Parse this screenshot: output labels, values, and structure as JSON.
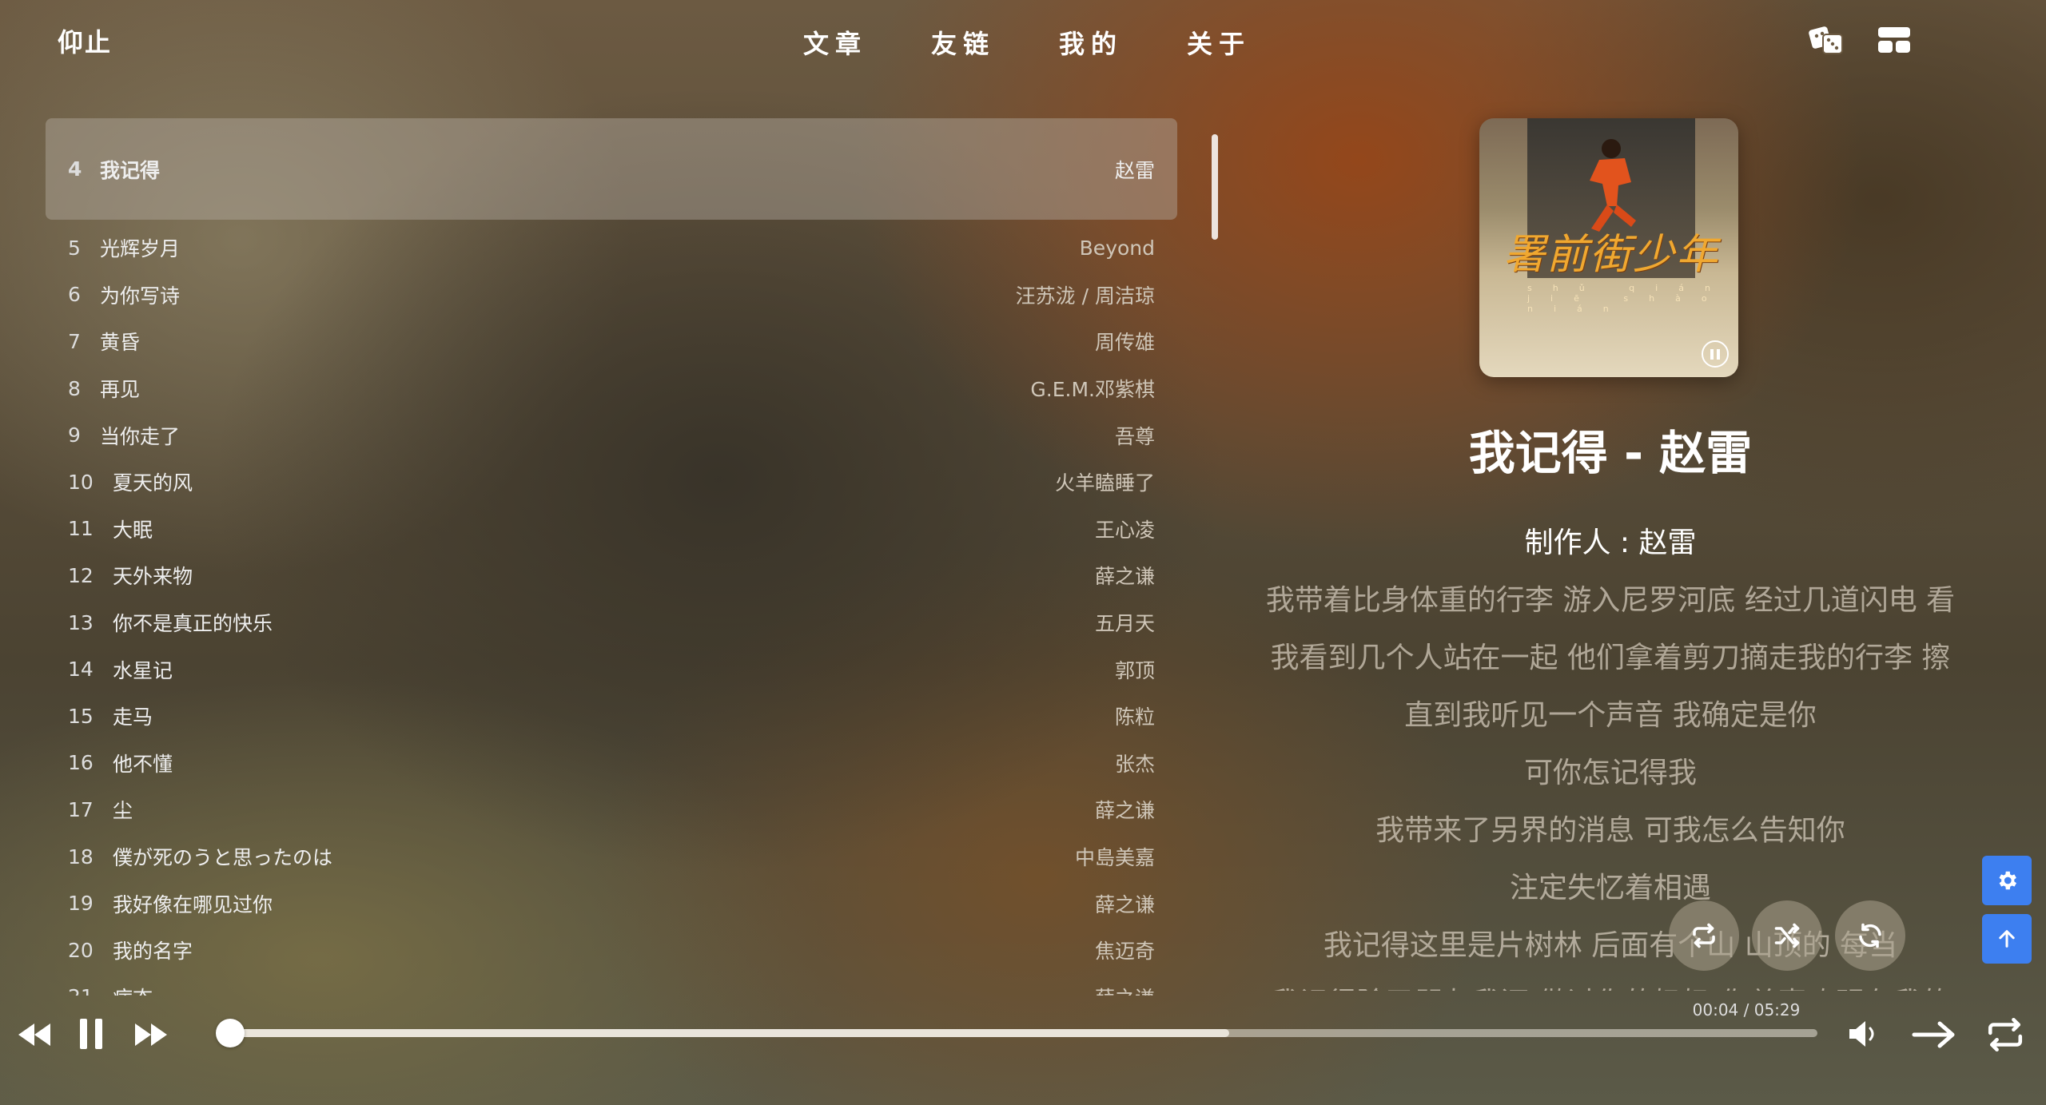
{
  "header": {
    "brand": "仰止",
    "nav": [
      "文章",
      "友链",
      "我的",
      "关于"
    ],
    "icons": [
      "dice-icon",
      "layout-icon"
    ]
  },
  "playlist": [
    {
      "num": "4",
      "title": "我记得",
      "artist": "赵雷",
      "active": true
    },
    {
      "num": "5",
      "title": "光辉岁月",
      "artist": "Beyond"
    },
    {
      "num": "6",
      "title": "为你写诗",
      "artist": "汪苏泷 / 周洁琼"
    },
    {
      "num": "7",
      "title": "黄昏",
      "artist": "周传雄"
    },
    {
      "num": "8",
      "title": "再见",
      "artist": "G.E.M.邓紫棋"
    },
    {
      "num": "9",
      "title": "当你走了",
      "artist": "吾尊"
    },
    {
      "num": "10",
      "title": "夏天的风",
      "artist": "火羊瞌睡了"
    },
    {
      "num": "11",
      "title": "大眠",
      "artist": "王心凌"
    },
    {
      "num": "12",
      "title": "天外来物",
      "artist": "薛之谦"
    },
    {
      "num": "13",
      "title": "你不是真正的快乐",
      "artist": "五月天"
    },
    {
      "num": "14",
      "title": "水星记",
      "artist": "郭顶"
    },
    {
      "num": "15",
      "title": "走马",
      "artist": "陈粒"
    },
    {
      "num": "16",
      "title": "他不懂",
      "artist": "张杰"
    },
    {
      "num": "17",
      "title": "尘",
      "artist": "薛之谦"
    },
    {
      "num": "18",
      "title": "僕が死のうと思ったのは",
      "artist": "中島美嘉"
    },
    {
      "num": "19",
      "title": "我好像在哪见过你",
      "artist": "薛之谦"
    },
    {
      "num": "20",
      "title": "我的名字",
      "artist": "焦迈奇"
    },
    {
      "num": "21",
      "title": "病态",
      "artist": "薛之谦"
    }
  ],
  "now_playing": {
    "cover_title": "署前街少年",
    "cover_pinyin": "shǔ qián jiē shào nián",
    "title": "我记得 - 赵雷",
    "producer": "制作人 : 赵雷",
    "lyrics": [
      "我带着比身体重的行李 游入尼罗河底 经过几道闪电 看",
      "我看到几个人站在一起 他们拿着剪刀摘走我的行李 擦",
      "直到我听见一个声音 我确定是你",
      "可你怎记得我",
      "我带来了另界的消息 可我怎么告知你",
      "注定失忆着相遇",
      "我记得这里是片树林 后面有个山 山顶的 每当",
      "我记得除了朋友我还 做过你的奶奶 你总喜欢明有我的"
    ],
    "time": "00:04 / 05:29",
    "progress_fraction": 0.001,
    "buffer_fraction": 0.63
  },
  "side_buttons": [
    "settings-icon",
    "arrow-up-icon"
  ]
}
